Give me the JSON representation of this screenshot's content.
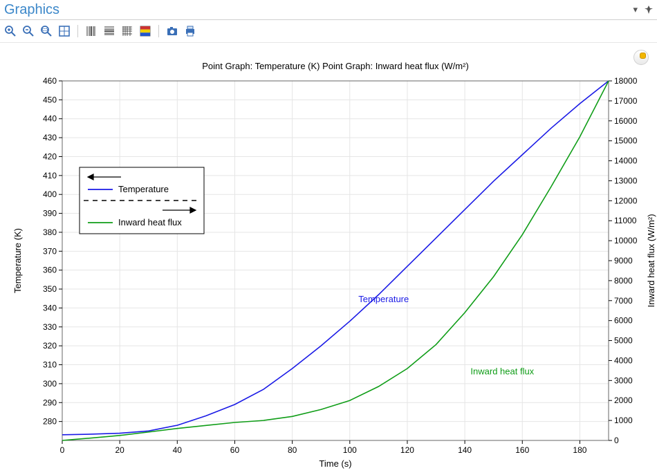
{
  "panel": {
    "title": "Graphics"
  },
  "toolbar": {
    "icons": [
      "zoom-in-icon",
      "zoom-out-icon",
      "zoom-box-icon",
      "zoom-extents-icon",
      "SEP",
      "log-x-icon",
      "log-y-icon",
      "log-xy-icon",
      "color-table-icon",
      "SEP",
      "snapshot-icon",
      "print-icon"
    ]
  },
  "chart_data": {
    "type": "line",
    "title": "Point Graph: Temperature (K)  Point Graph: Inward heat flux (W/m²)",
    "xlabel": "Time (s)",
    "ylabel_left": "Temperature (K)",
    "ylabel_right": "Inward heat flux (W/m²)",
    "xlim": [
      0,
      190
    ],
    "ylim_left": [
      270,
      460
    ],
    "ylim_right": [
      0,
      18000
    ],
    "xticks": [
      0,
      20,
      40,
      60,
      80,
      100,
      120,
      140,
      160,
      180
    ],
    "yticks_left": [
      280,
      290,
      300,
      310,
      320,
      330,
      340,
      350,
      360,
      370,
      380,
      390,
      400,
      410,
      420,
      430,
      440,
      450,
      460
    ],
    "yticks_right": [
      0,
      1000,
      2000,
      3000,
      4000,
      5000,
      6000,
      7000,
      8000,
      9000,
      10000,
      11000,
      12000,
      13000,
      14000,
      15000,
      16000,
      17000,
      18000
    ],
    "series": [
      {
        "name": "Temperature",
        "axis": "left",
        "color": "#1a1ae6",
        "x": [
          0,
          10,
          20,
          30,
          40,
          50,
          60,
          70,
          80,
          90,
          100,
          110,
          120,
          130,
          140,
          150,
          160,
          170,
          180,
          190
        ],
        "y": [
          273,
          273.3,
          273.8,
          275,
          278,
          283,
          289,
          297,
          308,
          320,
          333,
          347,
          362,
          377,
          392,
          407,
          421,
          435,
          448,
          460
        ]
      },
      {
        "name": "Inward heat flux",
        "axis": "right",
        "color": "#0f9d17",
        "x": [
          0,
          10,
          20,
          30,
          40,
          50,
          60,
          70,
          80,
          90,
          100,
          110,
          120,
          130,
          140,
          150,
          160,
          170,
          180,
          190
        ],
        "y": [
          0,
          120,
          250,
          420,
          600,
          750,
          900,
          1000,
          1200,
          1550,
          2000,
          2700,
          3600,
          4800,
          6400,
          8200,
          10300,
          12700,
          15200,
          18000
        ]
      }
    ],
    "annotations": [
      {
        "text": "Temperature",
        "series": 0,
        "x": 103,
        "y": 343,
        "color": "#1a1ae6"
      },
      {
        "text": "Inward heat flux",
        "series": 1,
        "x": 142,
        "y_right": 3300,
        "color": "#0f9d17"
      }
    ],
    "legend": {
      "position": [
        115,
        180
      ],
      "items_left": [
        "Temperature"
      ],
      "items_right": [
        "Inward heat flux"
      ]
    }
  }
}
